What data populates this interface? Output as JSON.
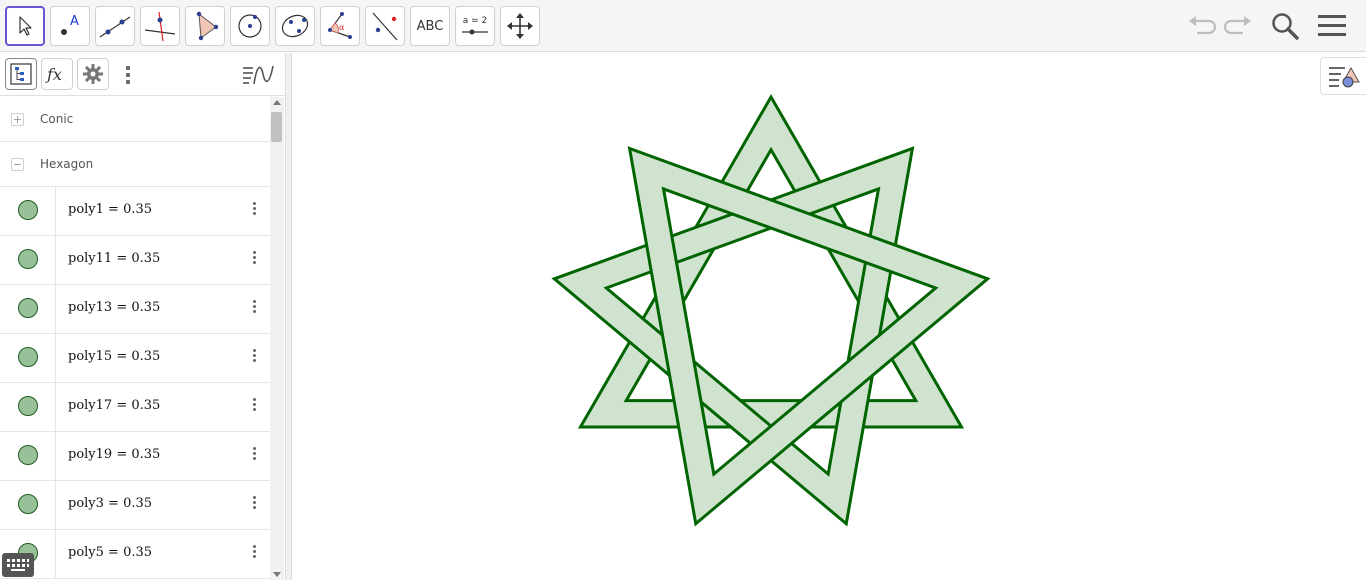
{
  "toolbar": {
    "tools": [
      {
        "name": "move-tool",
        "label": ""
      },
      {
        "name": "point-tool",
        "label": "A"
      },
      {
        "name": "line-tool",
        "label": ""
      },
      {
        "name": "perpendicular-line-tool",
        "label": ""
      },
      {
        "name": "polygon-tool",
        "label": ""
      },
      {
        "name": "circle-center-point-tool",
        "label": ""
      },
      {
        "name": "ellipse-tool",
        "label": ""
      },
      {
        "name": "angle-tool",
        "label": "α"
      },
      {
        "name": "reflect-tool",
        "label": ""
      },
      {
        "name": "text-tool",
        "label": "ABC"
      },
      {
        "name": "slider-tool",
        "label": "a = 2"
      },
      {
        "name": "move-graphics-view-tool",
        "label": ""
      }
    ],
    "accent_color": "#6557d2"
  },
  "algebra": {
    "groups": [
      {
        "label": "Conic",
        "toggle": "+"
      },
      {
        "label": "Hexagon",
        "toggle": "−"
      }
    ],
    "items": [
      {
        "name": "poly1",
        "value": "poly1 = 0.35"
      },
      {
        "name": "poly11",
        "value": "poly11 = 0.35"
      },
      {
        "name": "poly13",
        "value": "poly13 = 0.35"
      },
      {
        "name": "poly15",
        "value": "poly15 = 0.35"
      },
      {
        "name": "poly17",
        "value": "poly17 = 0.35"
      },
      {
        "name": "poly19",
        "value": "poly19 = 0.35"
      },
      {
        "name": "poly3",
        "value": "poly3 = 0.35"
      },
      {
        "name": "poly5",
        "value": "poly5 = 0.35"
      }
    ],
    "marble_color": "#99c199"
  },
  "graphics": {
    "figure": "nine-pointed star of interlaced polygon bands",
    "stroke_color": "#006400",
    "fill_color": "#cfe3cf"
  }
}
